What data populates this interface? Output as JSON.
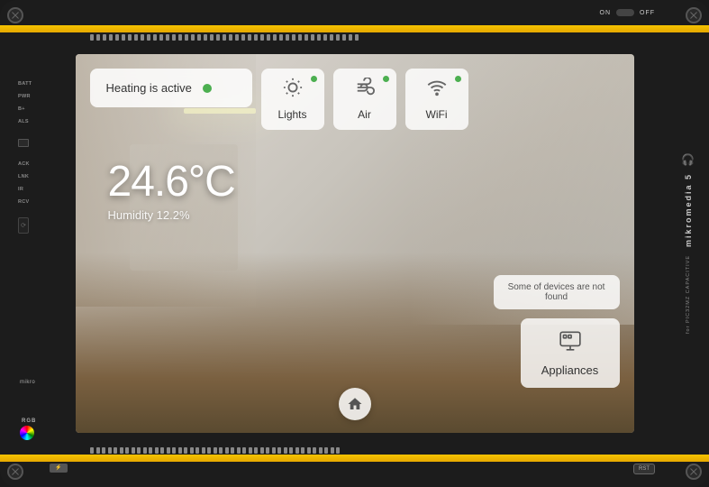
{
  "device": {
    "brand": "mikromedia 5",
    "sub_brand": "for PIC32MZ CAPACITIVE",
    "on_label": "ON",
    "off_label": "OFF"
  },
  "screen": {
    "heating": {
      "label": "Heating is active",
      "status": "active",
      "status_dot_color": "#4caf50"
    },
    "cards": [
      {
        "id": "lights",
        "label": "Lights",
        "icon": "💡",
        "active": true
      },
      {
        "id": "air",
        "label": "Air",
        "icon": "❄",
        "active": true
      },
      {
        "id": "wifi",
        "label": "WiFi",
        "icon": "📶",
        "active": true
      }
    ],
    "temperature": {
      "value": "24.6°C",
      "humidity_label": "Humidity 12.2%"
    },
    "warning": {
      "text": "Some of devices are not found"
    },
    "appliances": {
      "label": "Appliances",
      "icon": "🖨"
    },
    "home_button_label": "Home"
  }
}
